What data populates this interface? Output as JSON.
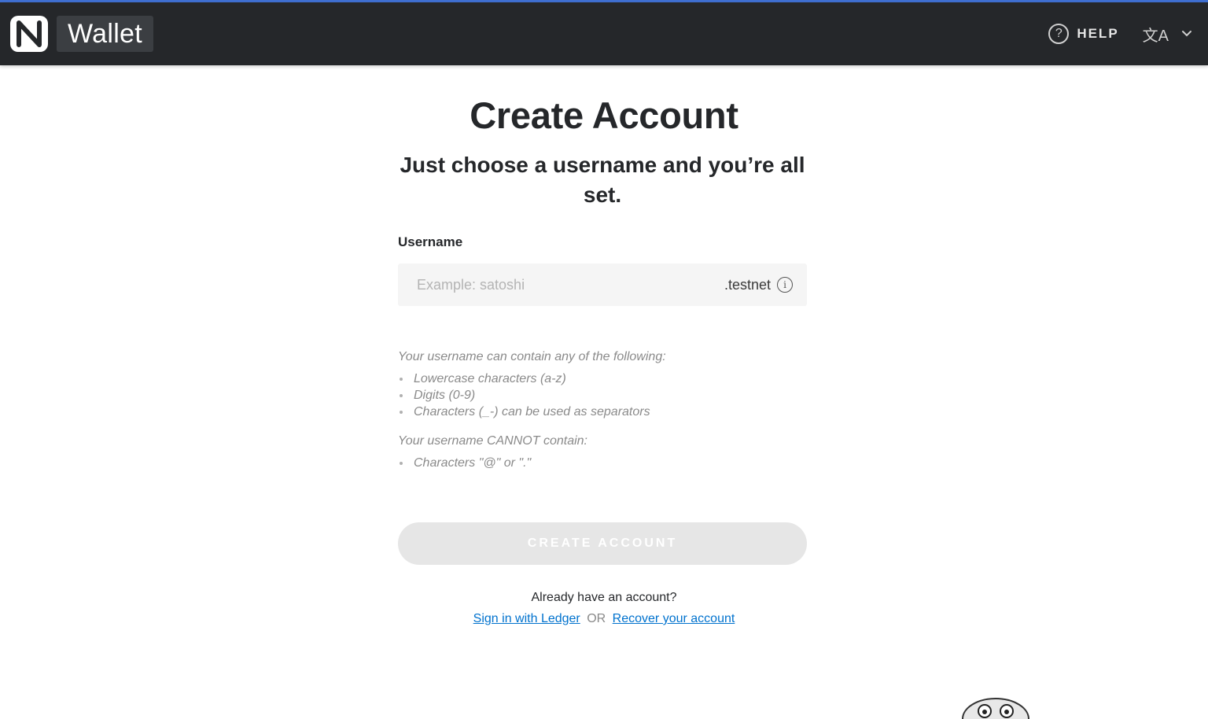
{
  "header": {
    "brand_label": "Wallet",
    "help_label": "HELP"
  },
  "page": {
    "title": "Create Account",
    "subtitle": "Just choose a username and you’re all set."
  },
  "form": {
    "username_label": "Username",
    "username_placeholder": "Example: satoshi",
    "username_value": "",
    "suffix": ".testnet"
  },
  "rules": {
    "allowed_heading": "Your username can contain any of the following:",
    "allowed": [
      "Lowercase characters (a-z)",
      "Digits (0-9)",
      "Characters (_-) can be used as separators"
    ],
    "forbidden_heading": "Your username CANNOT contain:",
    "forbidden": [
      "Characters \"@\" or \".\""
    ]
  },
  "actions": {
    "create_label": "CREATE ACCOUNT",
    "already_text": "Already have an account?",
    "ledger_link": "Sign in with Ledger",
    "or_text": "OR",
    "recover_link": "Recover your account"
  },
  "colors": {
    "header_bg": "#25272a",
    "accent_line": "#3f6fd1",
    "link": "#0072ce",
    "button_disabled": "#e6e6e6"
  }
}
